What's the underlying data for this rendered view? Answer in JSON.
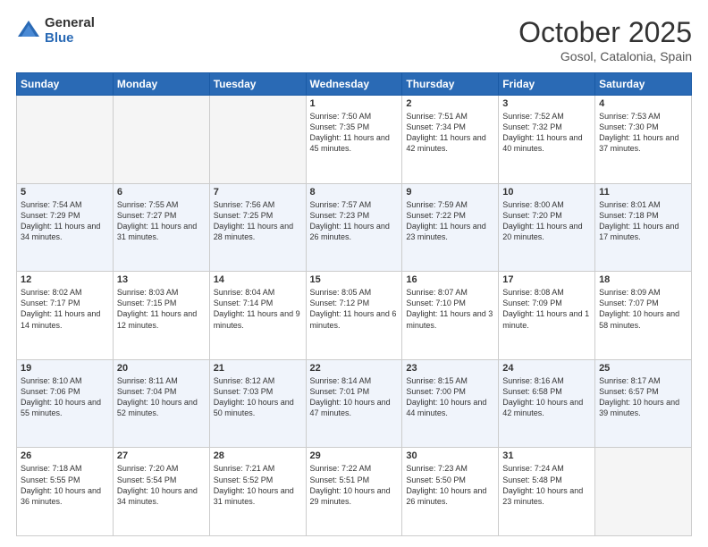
{
  "header": {
    "logo_general": "General",
    "logo_blue": "Blue",
    "month": "October 2025",
    "location": "Gosol, Catalonia, Spain"
  },
  "weekdays": [
    "Sunday",
    "Monday",
    "Tuesday",
    "Wednesday",
    "Thursday",
    "Friday",
    "Saturday"
  ],
  "weeks": [
    [
      {
        "day": "",
        "info": ""
      },
      {
        "day": "",
        "info": ""
      },
      {
        "day": "",
        "info": ""
      },
      {
        "day": "1",
        "info": "Sunrise: 7:50 AM\nSunset: 7:35 PM\nDaylight: 11 hours and 45 minutes."
      },
      {
        "day": "2",
        "info": "Sunrise: 7:51 AM\nSunset: 7:34 PM\nDaylight: 11 hours and 42 minutes."
      },
      {
        "day": "3",
        "info": "Sunrise: 7:52 AM\nSunset: 7:32 PM\nDaylight: 11 hours and 40 minutes."
      },
      {
        "day": "4",
        "info": "Sunrise: 7:53 AM\nSunset: 7:30 PM\nDaylight: 11 hours and 37 minutes."
      }
    ],
    [
      {
        "day": "5",
        "info": "Sunrise: 7:54 AM\nSunset: 7:29 PM\nDaylight: 11 hours and 34 minutes."
      },
      {
        "day": "6",
        "info": "Sunrise: 7:55 AM\nSunset: 7:27 PM\nDaylight: 11 hours and 31 minutes."
      },
      {
        "day": "7",
        "info": "Sunrise: 7:56 AM\nSunset: 7:25 PM\nDaylight: 11 hours and 28 minutes."
      },
      {
        "day": "8",
        "info": "Sunrise: 7:57 AM\nSunset: 7:23 PM\nDaylight: 11 hours and 26 minutes."
      },
      {
        "day": "9",
        "info": "Sunrise: 7:59 AM\nSunset: 7:22 PM\nDaylight: 11 hours and 23 minutes."
      },
      {
        "day": "10",
        "info": "Sunrise: 8:00 AM\nSunset: 7:20 PM\nDaylight: 11 hours and 20 minutes."
      },
      {
        "day": "11",
        "info": "Sunrise: 8:01 AM\nSunset: 7:18 PM\nDaylight: 11 hours and 17 minutes."
      }
    ],
    [
      {
        "day": "12",
        "info": "Sunrise: 8:02 AM\nSunset: 7:17 PM\nDaylight: 11 hours and 14 minutes."
      },
      {
        "day": "13",
        "info": "Sunrise: 8:03 AM\nSunset: 7:15 PM\nDaylight: 11 hours and 12 minutes."
      },
      {
        "day": "14",
        "info": "Sunrise: 8:04 AM\nSunset: 7:14 PM\nDaylight: 11 hours and 9 minutes."
      },
      {
        "day": "15",
        "info": "Sunrise: 8:05 AM\nSunset: 7:12 PM\nDaylight: 11 hours and 6 minutes."
      },
      {
        "day": "16",
        "info": "Sunrise: 8:07 AM\nSunset: 7:10 PM\nDaylight: 11 hours and 3 minutes."
      },
      {
        "day": "17",
        "info": "Sunrise: 8:08 AM\nSunset: 7:09 PM\nDaylight: 11 hours and 1 minute."
      },
      {
        "day": "18",
        "info": "Sunrise: 8:09 AM\nSunset: 7:07 PM\nDaylight: 10 hours and 58 minutes."
      }
    ],
    [
      {
        "day": "19",
        "info": "Sunrise: 8:10 AM\nSunset: 7:06 PM\nDaylight: 10 hours and 55 minutes."
      },
      {
        "day": "20",
        "info": "Sunrise: 8:11 AM\nSunset: 7:04 PM\nDaylight: 10 hours and 52 minutes."
      },
      {
        "day": "21",
        "info": "Sunrise: 8:12 AM\nSunset: 7:03 PM\nDaylight: 10 hours and 50 minutes."
      },
      {
        "day": "22",
        "info": "Sunrise: 8:14 AM\nSunset: 7:01 PM\nDaylight: 10 hours and 47 minutes."
      },
      {
        "day": "23",
        "info": "Sunrise: 8:15 AM\nSunset: 7:00 PM\nDaylight: 10 hours and 44 minutes."
      },
      {
        "day": "24",
        "info": "Sunrise: 8:16 AM\nSunset: 6:58 PM\nDaylight: 10 hours and 42 minutes."
      },
      {
        "day": "25",
        "info": "Sunrise: 8:17 AM\nSunset: 6:57 PM\nDaylight: 10 hours and 39 minutes."
      }
    ],
    [
      {
        "day": "26",
        "info": "Sunrise: 7:18 AM\nSunset: 5:55 PM\nDaylight: 10 hours and 36 minutes."
      },
      {
        "day": "27",
        "info": "Sunrise: 7:20 AM\nSunset: 5:54 PM\nDaylight: 10 hours and 34 minutes."
      },
      {
        "day": "28",
        "info": "Sunrise: 7:21 AM\nSunset: 5:52 PM\nDaylight: 10 hours and 31 minutes."
      },
      {
        "day": "29",
        "info": "Sunrise: 7:22 AM\nSunset: 5:51 PM\nDaylight: 10 hours and 29 minutes."
      },
      {
        "day": "30",
        "info": "Sunrise: 7:23 AM\nSunset: 5:50 PM\nDaylight: 10 hours and 26 minutes."
      },
      {
        "day": "31",
        "info": "Sunrise: 7:24 AM\nSunset: 5:48 PM\nDaylight: 10 hours and 23 minutes."
      },
      {
        "day": "",
        "info": ""
      }
    ]
  ]
}
